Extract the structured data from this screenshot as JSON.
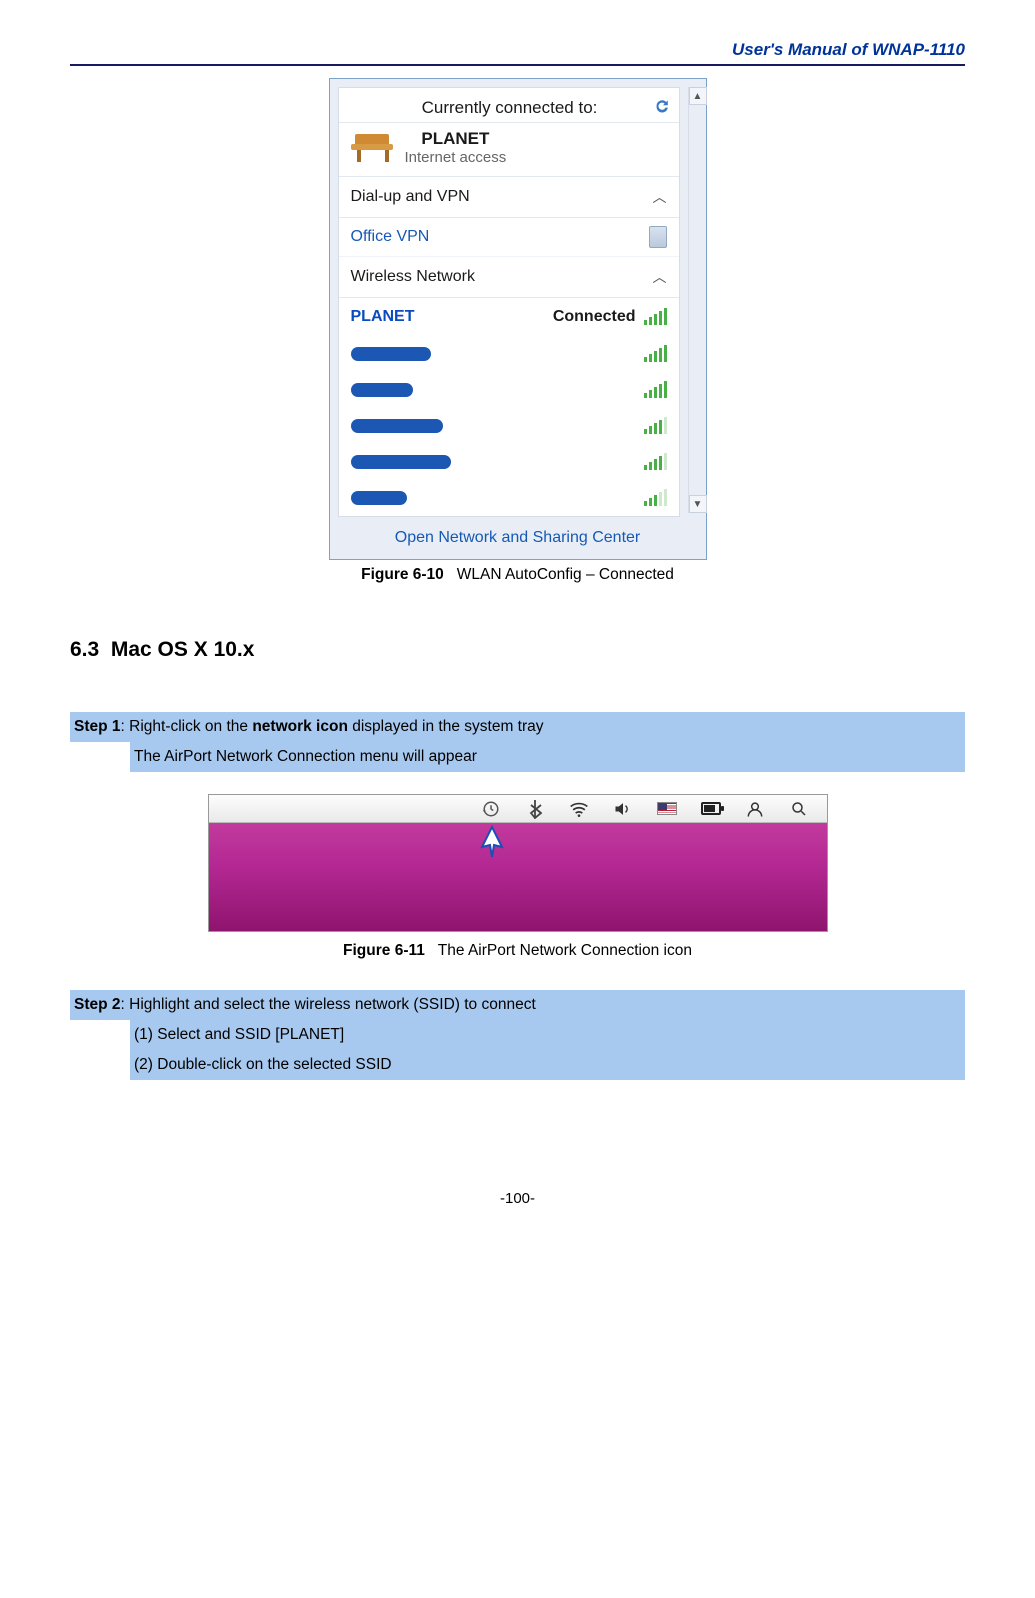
{
  "header": {
    "title": "User's Manual of WNAP-1110"
  },
  "figure1": {
    "label": "Figure 6-10",
    "caption": "WLAN AutoConfig – Connected",
    "flyout": {
      "currently_label": "Currently connected to:",
      "network_name": "PLANET",
      "network_sub": "Internet access",
      "dialup_label": "Dial-up and VPN",
      "vpn_item": "Office VPN",
      "wireless_label": "Wireless Network",
      "connected_ssid": "PLANET",
      "connected_status": "Connected",
      "footer_link": "Open Network and Sharing Center"
    }
  },
  "section": {
    "num": "6.3",
    "title": "Mac OS X 10.x"
  },
  "step1": {
    "label": "Step 1",
    "line1_a": ": Right-click on the ",
    "line1_b": "network icon",
    "line1_c": " displayed in the system tray",
    "line2": "The AirPort Network Connection menu will appear"
  },
  "figure2": {
    "label": "Figure 6-11",
    "caption": "The AirPort Network Connection icon"
  },
  "step2": {
    "label": "Step 2",
    "line1": ": Highlight and select the wireless network (SSID) to connect",
    "sub1": "(1)  Select and SSID [PLANET]",
    "sub2": "(2)  Double-click on the selected SSID"
  },
  "footer": {
    "page": "-100-"
  }
}
